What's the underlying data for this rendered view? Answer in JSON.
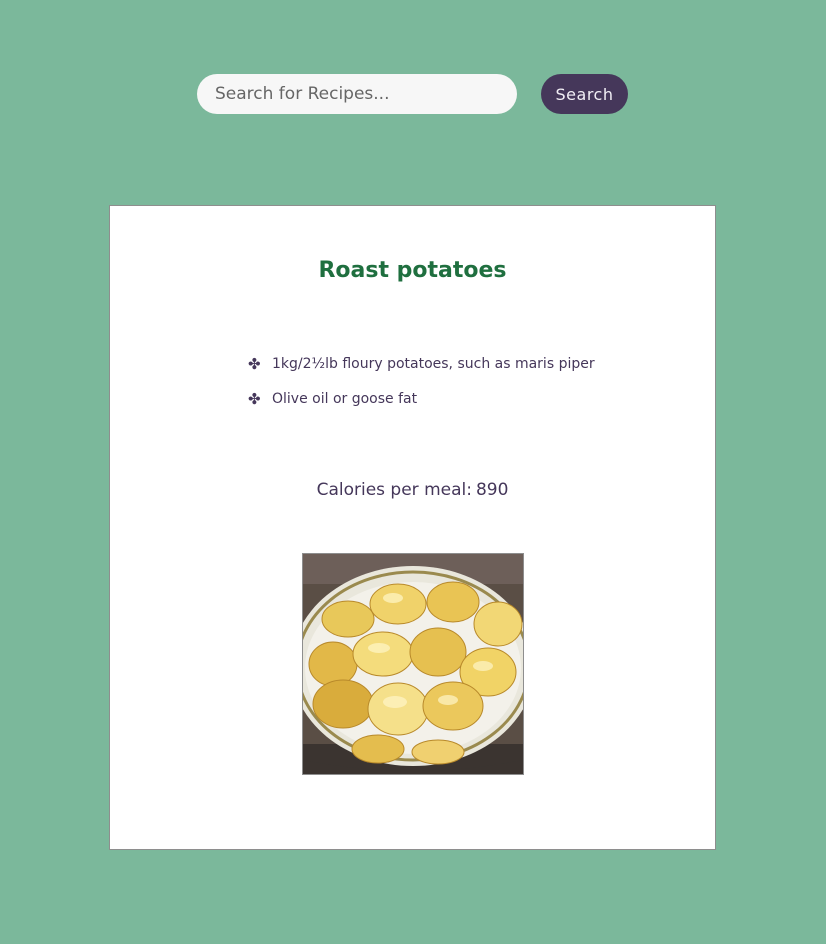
{
  "search": {
    "placeholder": "Search for Recipes...",
    "value": "",
    "button_label": "Search"
  },
  "recipe": {
    "title": "Roast potatoes",
    "ingredients": [
      "1kg/2½lb floury potatoes, such as maris piper",
      "Olive oil or goose fat"
    ],
    "calories_label": "Calories per meal:",
    "calories_value": "890"
  },
  "icons": {
    "ingredient_bullet": "four-leaf-clover-icon"
  },
  "colors": {
    "background": "#7bb89b",
    "accent": "#45375a",
    "title": "#1f6f3f"
  }
}
